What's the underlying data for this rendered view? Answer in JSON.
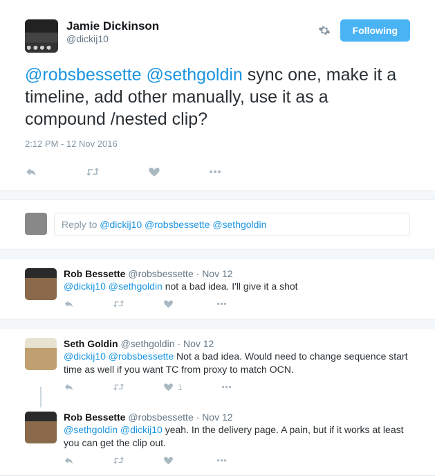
{
  "main": {
    "author_name": "Jamie Dickinson",
    "author_handle": "@dickij10",
    "follow_label": "Following",
    "mentions": [
      "@robsbessette",
      "@sethgoldin"
    ],
    "body_rest": " sync one, make it a timeline, add other manually, use it as a compound /nested clip?",
    "timestamp": "2:12 PM - 12 Nov 2016"
  },
  "reply_box": {
    "prefix": "Reply to ",
    "mentions": [
      "@dickij10",
      "@robsbessette",
      "@sethgoldin"
    ]
  },
  "replies": [
    {
      "name": "Rob Bessette",
      "handle": "@robsbessette",
      "date": "Nov 12",
      "mentions": [
        "@dickij10",
        "@sethgoldin"
      ],
      "body": " not a bad idea. I'll give it a shot",
      "likes": ""
    },
    {
      "name": "Seth Goldin",
      "handle": "@sethgoldin",
      "date": "Nov 12",
      "mentions": [
        "@dickij10",
        "@robsbessette"
      ],
      "body": " Not a bad idea. Would need to change sequence start time as well if you want TC from proxy to match OCN.",
      "likes": "1"
    },
    {
      "name": "Rob Bessette",
      "handle": "@robsbessette",
      "date": "Nov 12",
      "mentions": [
        "@sethgoldin",
        "@dickij10"
      ],
      "body": " yeah. In the delivery page. A pain, but if it works at least you can get the clip out.",
      "likes": ""
    }
  ]
}
